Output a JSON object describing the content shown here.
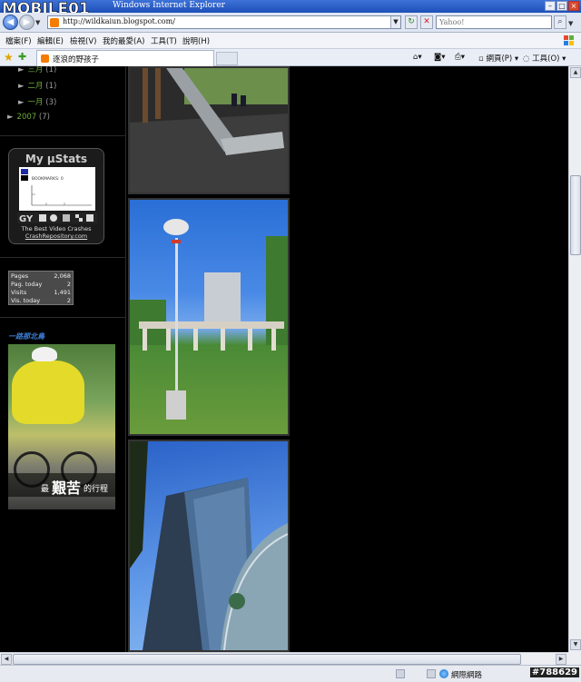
{
  "browser": {
    "window_title": "Windows Internet Explorer",
    "url": "http://wildkaiun.blogspot.com/",
    "search_placeholder": "Yahoo!",
    "menu": [
      "檔案(F)",
      "編輯(E)",
      "檢視(V)",
      "我的最愛(A)",
      "工具(T)",
      "說明(H)"
    ],
    "tab_title": "逐浪的野孩子",
    "command_bar": {
      "page": "網頁(P)",
      "tools": "工具(O)"
    },
    "status": {
      "zone": "網際網路"
    }
  },
  "sidebar": {
    "archive": [
      {
        "label": "三月",
        "count": "(1)"
      },
      {
        "label": "二月",
        "count": "(1)"
      },
      {
        "label": "一月",
        "count": "(3)"
      },
      {
        "label": "2007",
        "count": "(7)"
      }
    ],
    "ustats": {
      "title": "My µStats",
      "graph_caption": "BOOKMARKS: 0",
      "tag_line": "The Best Video Crashes",
      "link": "CrashRepository.com"
    },
    "counter": [
      {
        "key": "Pages",
        "value": "2,068"
      },
      {
        "key": "Pag. today",
        "value": "2"
      },
      {
        "key": "Visits",
        "value": "1,491"
      },
      {
        "key": "Vis. today",
        "value": "2"
      }
    ],
    "section_title": "一路那北鳥",
    "banner_caption": {
      "prefix": "最",
      "emphasis": "艱苦",
      "suffix": "的行程"
    }
  },
  "watermark": "#788629",
  "colors": {
    "archive_link": "#6fae3a",
    "section_title": "#3c7fd6",
    "page_bg": "#000000"
  }
}
